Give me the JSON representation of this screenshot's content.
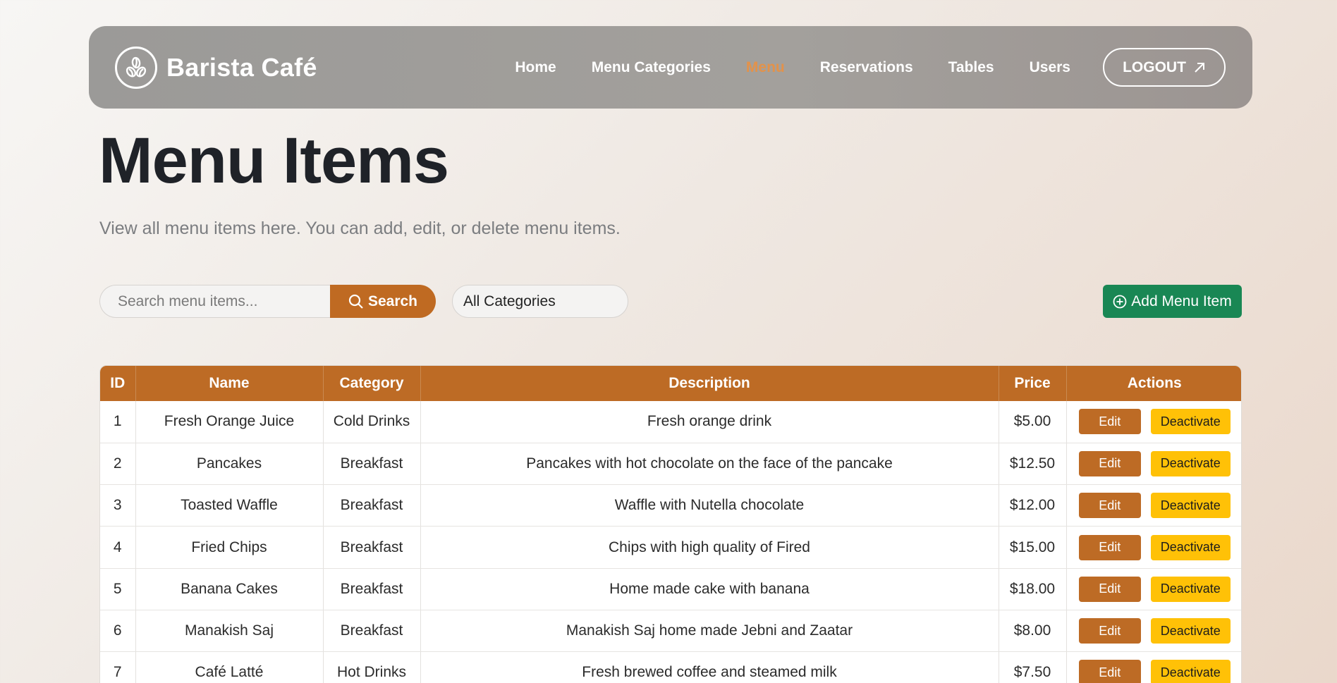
{
  "brand": {
    "name": "Barista Café"
  },
  "nav": {
    "items": [
      {
        "label": "Home",
        "active": false
      },
      {
        "label": "Menu Categories",
        "active": false
      },
      {
        "label": "Menu",
        "active": true
      },
      {
        "label": "Reservations",
        "active": false
      },
      {
        "label": "Tables",
        "active": false
      },
      {
        "label": "Users",
        "active": false
      }
    ],
    "logout_label": "LOGOUT"
  },
  "page": {
    "title": "Menu Items",
    "subtitle": "View all menu items here. You can add, edit, or delete menu items."
  },
  "toolbar": {
    "search_placeholder": "Search menu items...",
    "search_label": "Search",
    "category_selected": "All Categories",
    "add_label": "Add Menu Item"
  },
  "table": {
    "columns": [
      "ID",
      "Name",
      "Category",
      "Description",
      "Price",
      "Actions"
    ],
    "edit_label": "Edit",
    "deactivate_label": "Deactivate",
    "rows": [
      {
        "id": "1",
        "name": "Fresh Orange Juice",
        "category": "Cold Drinks",
        "description": "Fresh orange drink",
        "price": "$5.00"
      },
      {
        "id": "2",
        "name": "Pancakes",
        "category": "Breakfast",
        "description": "Pancakes with hot chocolate on the face of the pancake",
        "price": "$12.50"
      },
      {
        "id": "3",
        "name": "Toasted Waffle",
        "category": "Breakfast",
        "description": "Waffle with Nutella chocolate",
        "price": "$12.00"
      },
      {
        "id": "4",
        "name": "Fried Chips",
        "category": "Breakfast",
        "description": "Chips with high quality of Fired",
        "price": "$15.00"
      },
      {
        "id": "5",
        "name": "Banana Cakes",
        "category": "Breakfast",
        "description": "Home made cake with banana",
        "price": "$18.00"
      },
      {
        "id": "6",
        "name": "Manakish Saj",
        "category": "Breakfast",
        "description": "Manakish Saj home made Jebni and Zaatar",
        "price": "$8.00"
      },
      {
        "id": "7",
        "name": "Café Latté",
        "category": "Hot Drinks",
        "description": "Fresh brewed coffee and steamed milk",
        "price": "$7.50"
      }
    ]
  },
  "colors": {
    "accent": "#bd6b25",
    "active_nav": "#e3924a",
    "add_button": "#198754",
    "deactivate_button": "#ffc107"
  },
  "icons": {
    "logo": "coffee-beans-icon",
    "logout": "arrow-up-right-icon",
    "search": "search-icon",
    "add": "plus-circle-icon"
  }
}
